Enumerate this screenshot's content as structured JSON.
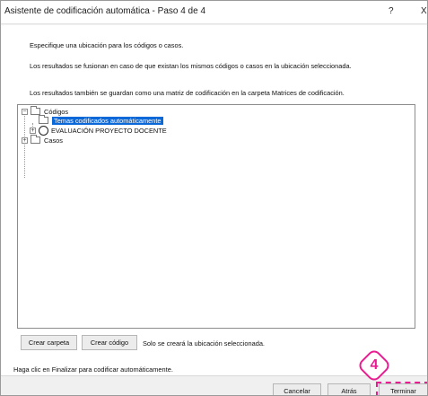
{
  "window": {
    "title": "Asistente de codificación automática - Paso 4 de 4",
    "help_label": "?",
    "close_label": "X"
  },
  "instructions": {
    "line1": "Especifique una ubicación para los códigos o casos.",
    "line2": "Los resultados se fusionan en caso de que existan los mismos códigos o casos en la ubicación seleccionada.",
    "line3": "Los resultados también se guardan como una matriz de codificación en la carpeta Matrices de codificación."
  },
  "tree": {
    "codigos": "Códigos",
    "temas": "Temas codificados automáticamente",
    "evaluacion": "EVALUACIÓN PROYECTO DOCENTE",
    "casos": "Casos",
    "expand_symbol": "+",
    "collapse_symbol": "−"
  },
  "actions": {
    "create_folder": "Crear carpeta",
    "create_code": "Crear código",
    "note": "Solo se creará la ubicación seleccionada."
  },
  "footer": {
    "hint": "Haga clic en Finalizar para codificar automáticamente.",
    "cancel": "Cancelar",
    "back": "Atrás",
    "finish": "Terminar"
  },
  "annotation": {
    "step_number": "4",
    "color": "#e81d90"
  }
}
